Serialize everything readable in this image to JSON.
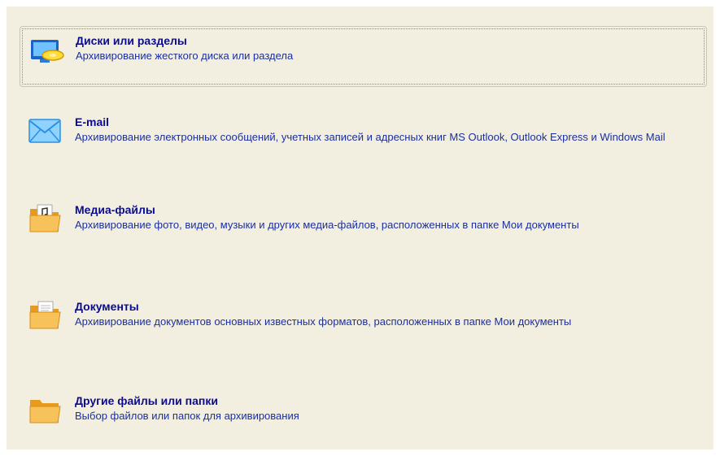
{
  "options": [
    {
      "title": "Диски или разделы",
      "description": "Архивирование жесткого диска или раздела",
      "icon": "monitor-disk-icon",
      "selected": true
    },
    {
      "title": "E-mail",
      "description": "Архивирование электронных сообщений, учетных записей и адресных книг MS Outlook, Outlook Express и Windows Mail",
      "icon": "envelope-icon",
      "selected": false
    },
    {
      "title": "Медиа-файлы",
      "description": "Архивирование фото, видео, музыки и других медиа-файлов, расположенных в папке Мои документы",
      "icon": "media-folder-icon",
      "selected": false
    },
    {
      "title": "Документы",
      "description": "Архивирование документов основных известных форматов, расположенных в папке Мои документы",
      "icon": "documents-folder-icon",
      "selected": false
    },
    {
      "title": "Другие файлы или папки",
      "description": "Выбор файлов или папок для архивирования",
      "icon": "folder-icon",
      "selected": false
    }
  ],
  "colors": {
    "panel_background": "#f2efe1",
    "title_text": "#0b0b8f",
    "description_text": "#1a2fa0",
    "folder_yellow": "#f5b63b"
  }
}
